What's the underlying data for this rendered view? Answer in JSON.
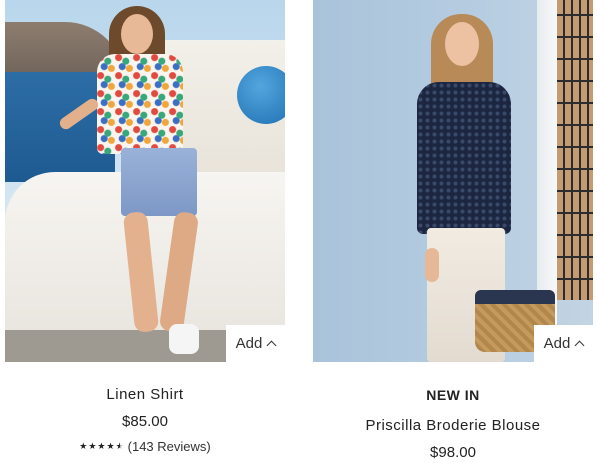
{
  "products": [
    {
      "name": "Linen Shirt",
      "price": "$85.00",
      "add_label": "Add",
      "rating": {
        "stars": 4.5,
        "max": 5,
        "reviews_text": "(143 Reviews)"
      }
    },
    {
      "badge": "NEW IN",
      "name": "Priscilla Broderie Blouse",
      "price": "$98.00",
      "add_label": "Add"
    }
  ],
  "icons": {
    "add_chevron": "chevron-up-icon",
    "star": "star-icon"
  }
}
